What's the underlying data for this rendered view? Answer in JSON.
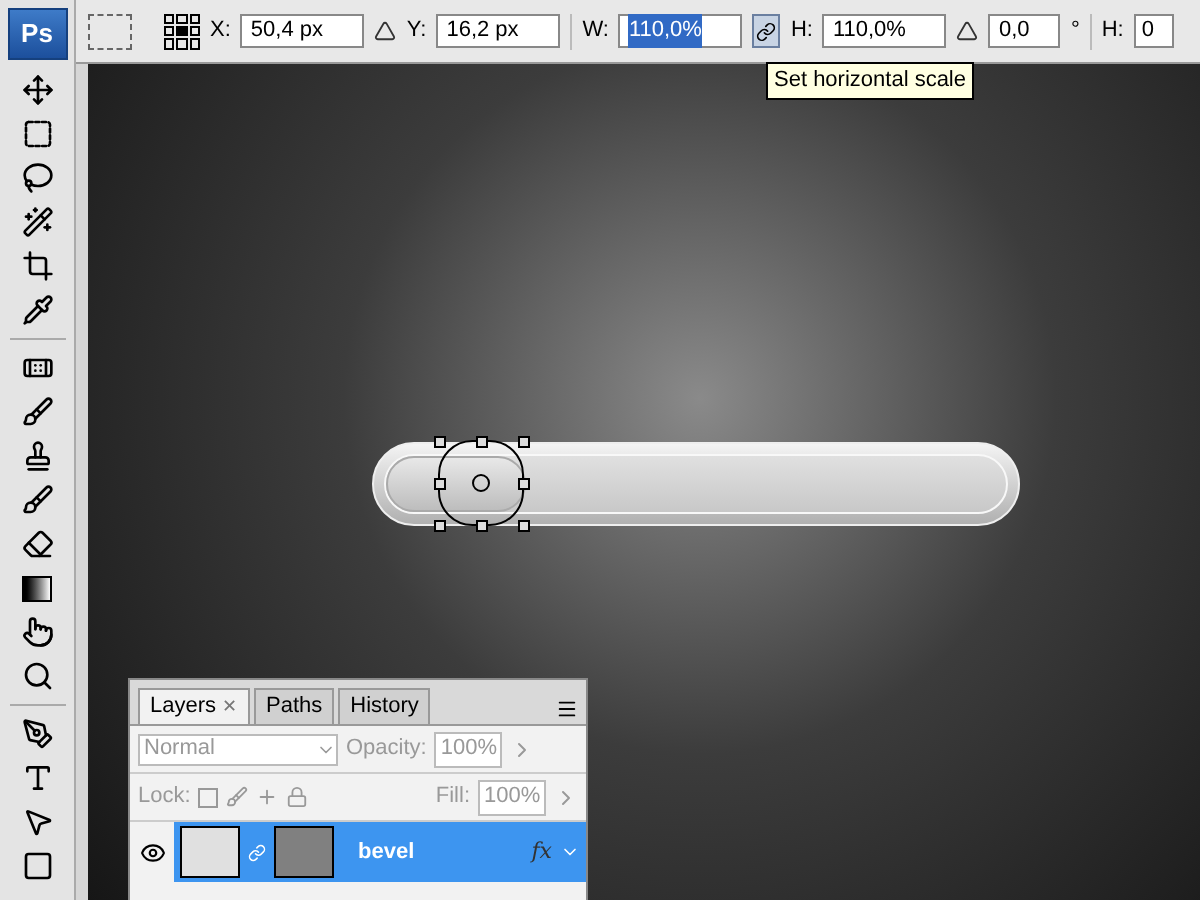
{
  "app_logo": "Ps",
  "options_bar": {
    "fields": [
      {
        "label": "X:",
        "value": "50,4 px",
        "highlighted": false
      },
      {
        "label": "Y:",
        "value": "16,2 px",
        "highlighted": false
      },
      {
        "label": "W:",
        "value": "110,0%",
        "highlighted": true
      },
      {
        "label": "H:",
        "value": "110,0%",
        "highlighted": false
      },
      {
        "value": "0,0",
        "highlighted": false
      }
    ],
    "degree_sign": "°",
    "cut_label": "H:",
    "cut_value": "0",
    "tooltip": "Set horizontal scale"
  },
  "layers_panel": {
    "tab_close": "✕",
    "tabs": [
      {
        "label": "Layers",
        "selected": true
      },
      {
        "label": "Paths",
        "selected": false
      },
      {
        "label": "History",
        "selected": false
      }
    ],
    "blend_mode": "Normal",
    "opacity_label": "Opacity:",
    "opacity": "100%",
    "lock_label": "Lock:",
    "fill_label": "Fill:",
    "fill": "100%",
    "layers": [
      {
        "name": "bevel",
        "selected": true,
        "visible": true,
        "effects": "fx"
      }
    ]
  }
}
